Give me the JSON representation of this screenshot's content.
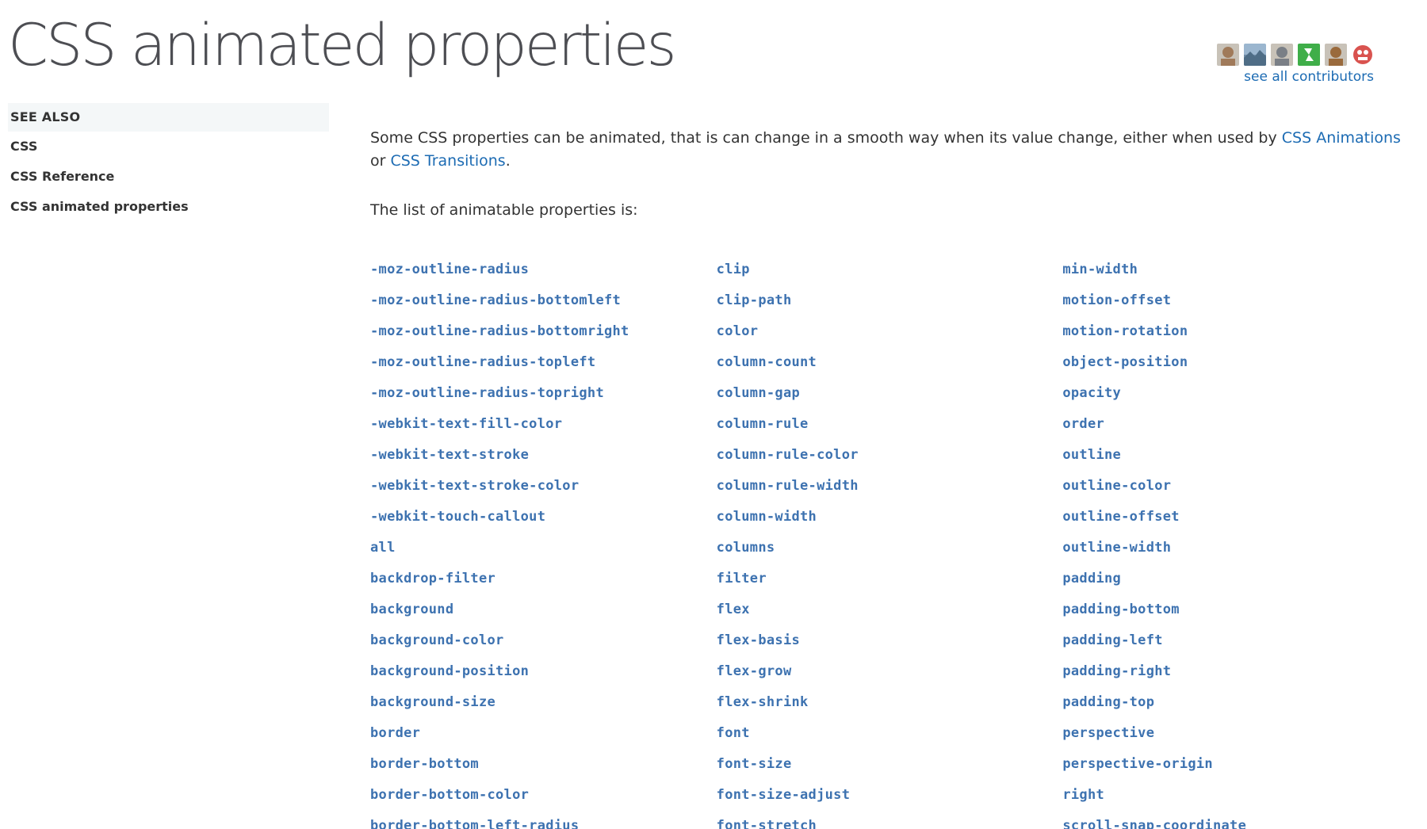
{
  "page": {
    "title": "CSS animated properties"
  },
  "contributors": {
    "see_all_label": "see all contributors",
    "avatars": [
      {
        "icon": "avatar-photo-man-glasses-icon",
        "color": "#a07a5a"
      },
      {
        "icon": "avatar-photo-landscape-icon",
        "color": "#6f8ca8"
      },
      {
        "icon": "avatar-photo-man-icon",
        "color": "#7a7f86"
      },
      {
        "icon": "avatar-logo-green-icon",
        "color": "#3fae49"
      },
      {
        "icon": "avatar-photo-portrait-icon",
        "color": "#9a6a3c"
      },
      {
        "icon": "avatar-monster-face-icon",
        "color": "#d9534f"
      }
    ]
  },
  "sidebar": {
    "heading": "SEE ALSO",
    "links": [
      {
        "label": "CSS"
      },
      {
        "label": "CSS Reference"
      },
      {
        "label": "CSS animated properties"
      }
    ]
  },
  "main": {
    "intro_text_1": "Some CSS properties can be animated, that is can change in a smooth way when its value change, either when used by ",
    "link_css_animations": "CSS Animations",
    "intro_text_2": " or ",
    "link_css_transitions": "CSS Transitions",
    "intro_text_3": ".",
    "list_intro": "The list of animatable properties is:",
    "columns": [
      [
        "-moz-outline-radius",
        "-moz-outline-radius-bottomleft",
        "-moz-outline-radius-bottomright",
        "-moz-outline-radius-topleft",
        "-moz-outline-radius-topright",
        "-webkit-text-fill-color",
        "-webkit-text-stroke",
        "-webkit-text-stroke-color",
        "-webkit-touch-callout",
        "all",
        "backdrop-filter",
        "background",
        "background-color",
        "background-position",
        "background-size",
        "border",
        "border-bottom",
        "border-bottom-color",
        "border-bottom-left-radius"
      ],
      [
        "clip",
        "clip-path",
        "color",
        "column-count",
        "column-gap",
        "column-rule",
        "column-rule-color",
        "column-rule-width",
        "column-width",
        "columns",
        "filter",
        "flex",
        "flex-basis",
        "flex-grow",
        "flex-shrink",
        "font",
        "font-size",
        "font-size-adjust",
        "font-stretch"
      ],
      [
        "min-width",
        "motion-offset",
        "motion-rotation",
        "object-position",
        "opacity",
        "order",
        "outline",
        "outline-color",
        "outline-offset",
        "outline-width",
        "padding",
        "padding-bottom",
        "padding-left",
        "padding-right",
        "padding-top",
        "perspective",
        "perspective-origin",
        "right",
        "scroll-snap-coordinate"
      ]
    ]
  },
  "colors": {
    "link": "#3d72b0",
    "title": "#4d4e53",
    "text": "#333333",
    "sidebar_heading_bg": "#f4f7f8"
  }
}
